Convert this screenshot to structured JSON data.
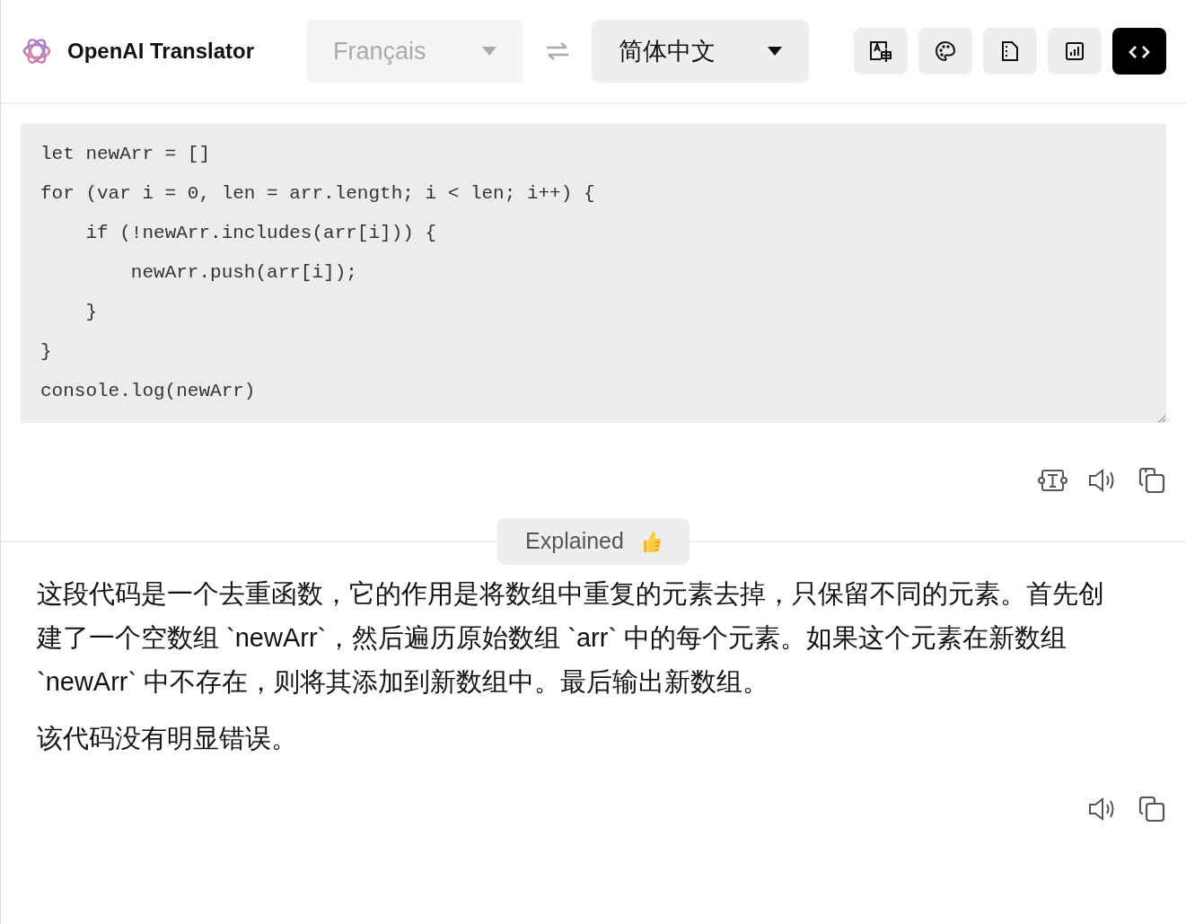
{
  "header": {
    "app_title": "OpenAI Translator",
    "source_language": {
      "value": "Français",
      "disabled": true
    },
    "target_language": {
      "value": "简体中文",
      "disabled": false
    },
    "modes": [
      {
        "kind": "translate",
        "selected": false
      },
      {
        "kind": "palette",
        "selected": false
      },
      {
        "kind": "document",
        "selected": false
      },
      {
        "kind": "chart",
        "selected": false
      },
      {
        "kind": "code",
        "selected": true
      }
    ]
  },
  "source_text": "let newArr = []\nfor (var i = 0, len = arr.length; i < len; i++) {\n    if (!newArr.includes(arr[i])) {\n        newArr.push(arr[i]);\n    }\n}\nconsole.log(newArr)",
  "result": {
    "badge": "Explained",
    "paragraphs": [
      "这段代码是一个去重函数，它的作用是将数组中重复的元素去掉，只保留不同的元素。首先创建了一个空数组 `newArr`，然后遍历原始数组 `arr` 中的每个元素。如果这个元素在新数组 `newArr` 中不存在，则将其添加到新数组中。最后输出新数组。",
      "该代码没有明显错误。"
    ]
  }
}
